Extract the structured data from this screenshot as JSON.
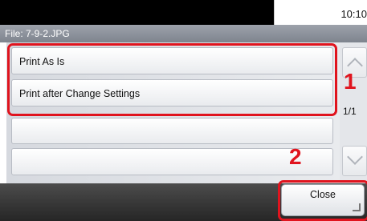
{
  "status": {
    "time": "10:10"
  },
  "file": {
    "label": "File:  7-9-2.JPG"
  },
  "list": {
    "items": [
      {
        "label": "Print As Is"
      },
      {
        "label": "Print after Change Settings"
      },
      {
        "label": ""
      },
      {
        "label": ""
      }
    ],
    "page_indicator": "1/1"
  },
  "callouts": {
    "one": "1",
    "two": "2"
  },
  "footer": {
    "close_label": "Close"
  },
  "colors": {
    "highlight": "#e0141e",
    "bar_dark": "#262626"
  }
}
